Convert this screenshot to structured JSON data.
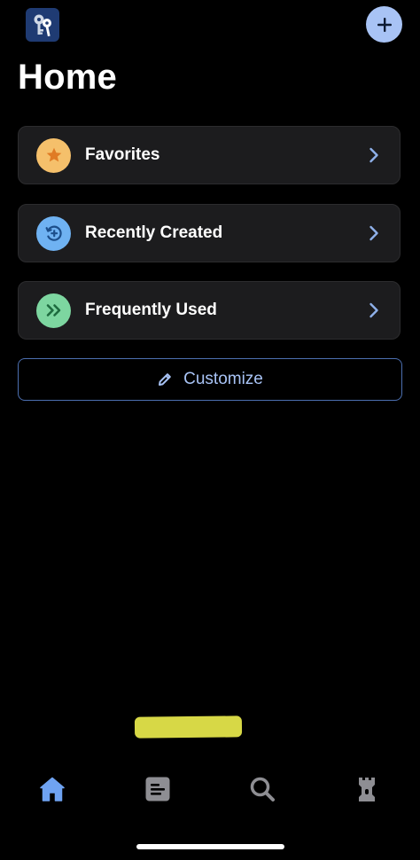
{
  "header": {
    "title": "Home",
    "logo_icon": "keys-icon",
    "add_icon": "plus-icon"
  },
  "cards": [
    {
      "label": "Favorites",
      "icon": "star-icon",
      "icon_bg": "#f5c06b",
      "icon_fg": "#e07b24"
    },
    {
      "label": "Recently Created",
      "icon": "clock-plus-icon",
      "icon_bg": "#6fb2f2",
      "icon_fg": "#1c4e8a"
    },
    {
      "label": "Frequently Used",
      "icon": "double-chevron-icon",
      "icon_bg": "#7dd6a0",
      "icon_fg": "#1e6b3f"
    }
  ],
  "customize": {
    "label": "Customize",
    "icon": "pencil-icon"
  },
  "tabs": [
    {
      "name": "home",
      "icon": "home-icon",
      "active": true
    },
    {
      "name": "vault",
      "icon": "list-icon",
      "active": false
    },
    {
      "name": "search",
      "icon": "search-icon",
      "active": false
    },
    {
      "name": "fortress",
      "icon": "castle-icon",
      "active": false
    }
  ],
  "colors": {
    "accent": "#a8c3f5",
    "card_bg": "#1c1c1e",
    "chevron": "#8fb1ea",
    "tab_active": "#6fa3f2",
    "tab_inactive": "#8e8e93",
    "highlight": "#e3e44a"
  }
}
